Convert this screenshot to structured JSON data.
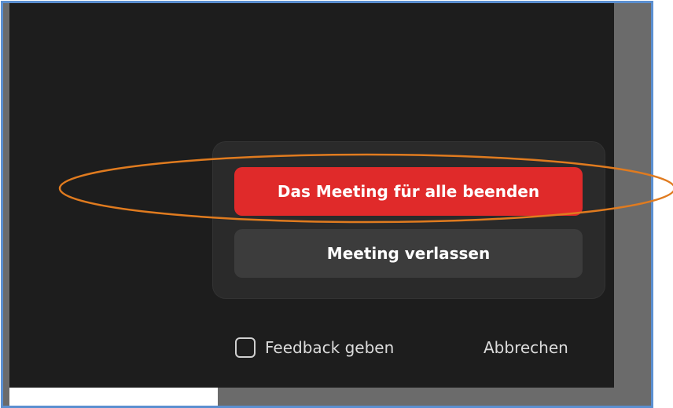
{
  "dialog": {
    "end_for_all_label": "Das Meeting für alle beenden",
    "leave_label": "Meeting verlassen",
    "feedback_label": "Feedback geben",
    "feedback_checked": false,
    "cancel_label": "Abbrechen"
  },
  "colors": {
    "frame_border": "#5b8fd0",
    "danger": "#e02a2a",
    "highlight": "#e07b1f",
    "background": "#1d1d1d"
  },
  "annotation": {
    "shape": "ellipse",
    "target": "end_for_all_button"
  }
}
